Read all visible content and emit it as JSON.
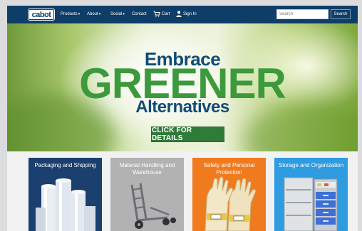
{
  "brand": {
    "logo_text": "cabot"
  },
  "nav": {
    "items": [
      {
        "label": "Products",
        "caret": "▾"
      },
      {
        "label": "About",
        "caret": "▾"
      },
      {
        "label": "Social",
        "caret": "▾"
      },
      {
        "label": "Contact"
      }
    ],
    "cart_label": "Cart",
    "signin_label": "Sign In"
  },
  "search": {
    "placeholder": "Search",
    "button_label": "Search"
  },
  "hero": {
    "line1": "Embrace",
    "line2": "GREENER",
    "line3": "Alternatives",
    "cta_label": "CLICK FOR DETAILS"
  },
  "categories": [
    {
      "title": "Packaging and Shipping",
      "color": "#1b3f6e"
    },
    {
      "title": "Material Handling and Warehouse",
      "color": "#b2b2b2"
    },
    {
      "title": "Safety and Personal Protection",
      "color": "#f07a1e"
    },
    {
      "title": "Storage and Organization",
      "color": "#2f9be0"
    }
  ],
  "colors": {
    "navbar": "#0e3d68",
    "green": "#3c9a3c",
    "navy_text": "#0f4b78",
    "cta": "#2f7c3a"
  },
  "icons": [
    "cart-icon",
    "user-icon"
  ]
}
